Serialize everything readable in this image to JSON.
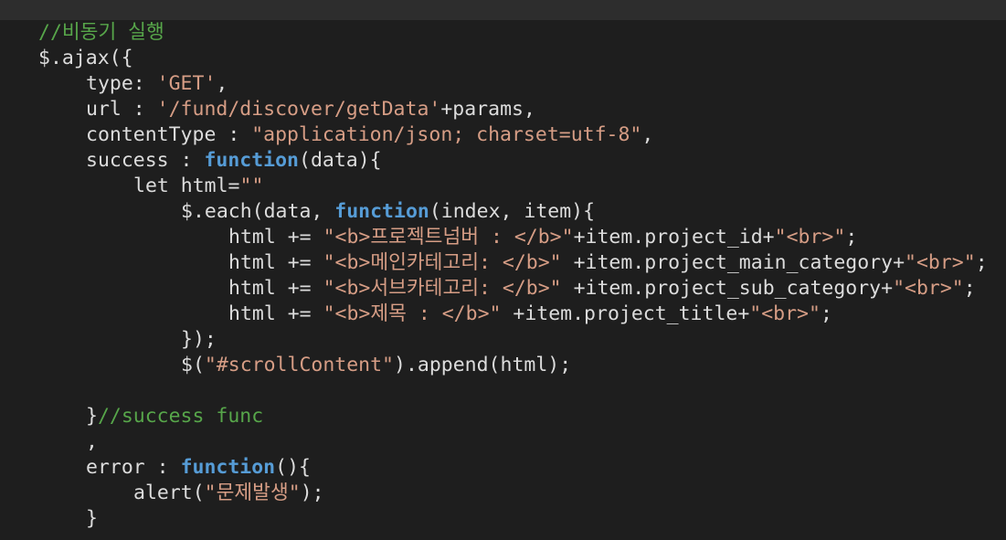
{
  "editor": {
    "lines": [
      [
        {
          "t": "comment",
          "v": "//비동기 실행"
        }
      ],
      [
        {
          "t": "plain",
          "v": "$.ajax({"
        }
      ],
      [
        {
          "t": "plain",
          "v": "type: "
        },
        {
          "t": "string",
          "v": "'GET'"
        },
        {
          "t": "plain",
          "v": ","
        }
      ],
      [
        {
          "t": "plain",
          "v": "url : "
        },
        {
          "t": "string",
          "v": "'/fund/discover/getData'"
        },
        {
          "t": "plain",
          "v": "+params,"
        }
      ],
      [
        {
          "t": "plain",
          "v": "contentType : "
        },
        {
          "t": "string",
          "v": "\"application/json; charset=utf-8\""
        },
        {
          "t": "plain",
          "v": ","
        }
      ],
      [
        {
          "t": "plain",
          "v": "success : "
        },
        {
          "t": "keyword",
          "v": "function"
        },
        {
          "t": "plain",
          "v": "(data){"
        }
      ],
      [
        {
          "t": "plain",
          "v": "let html="
        },
        {
          "t": "string",
          "v": "\"\""
        }
      ],
      [
        {
          "t": "plain",
          "v": "$.each(data, "
        },
        {
          "t": "keyword",
          "v": "function"
        },
        {
          "t": "plain",
          "v": "(index, item){"
        }
      ],
      [
        {
          "t": "plain",
          "v": "html += "
        },
        {
          "t": "string",
          "v": "\"<b>프로젝트넘버 : </b>\""
        },
        {
          "t": "plain",
          "v": "+item.project_id+"
        },
        {
          "t": "string",
          "v": "\"<br>\""
        },
        {
          "t": "plain",
          "v": ";"
        }
      ],
      [
        {
          "t": "plain",
          "v": "html += "
        },
        {
          "t": "string",
          "v": "\"<b>메인카테고리: </b>\""
        },
        {
          "t": "plain",
          "v": " +item.project_main_category+"
        },
        {
          "t": "string",
          "v": "\"<br>\""
        },
        {
          "t": "plain",
          "v": ";"
        }
      ],
      [
        {
          "t": "plain",
          "v": "html += "
        },
        {
          "t": "string",
          "v": "\"<b>서브카테고리: </b>\""
        },
        {
          "t": "plain",
          "v": " +item.project_sub_category+"
        },
        {
          "t": "string",
          "v": "\"<br>\""
        },
        {
          "t": "plain",
          "v": ";"
        }
      ],
      [
        {
          "t": "plain",
          "v": "html += "
        },
        {
          "t": "string",
          "v": "\"<b>제목 : </b>\""
        },
        {
          "t": "plain",
          "v": " +item.project_title+"
        },
        {
          "t": "string",
          "v": "\"<br>\""
        },
        {
          "t": "plain",
          "v": ";"
        }
      ],
      [
        {
          "t": "plain",
          "v": "});"
        }
      ],
      [
        {
          "t": "plain",
          "v": "$("
        },
        {
          "t": "string",
          "v": "\"#scrollContent\""
        },
        {
          "t": "plain",
          "v": ").append(html);"
        }
      ],
      [],
      [
        {
          "t": "plain",
          "v": "}"
        },
        {
          "t": "comment",
          "v": "//success func"
        }
      ],
      [
        {
          "t": "plain",
          "v": ","
        }
      ],
      [
        {
          "t": "plain",
          "v": "error : "
        },
        {
          "t": "keyword",
          "v": "function"
        },
        {
          "t": "plain",
          "v": "(){"
        }
      ],
      [
        {
          "t": "plain",
          "v": "alert("
        },
        {
          "t": "string",
          "v": "\"문제발생\""
        },
        {
          "t": "plain",
          "v": ");"
        }
      ],
      [
        {
          "t": "plain",
          "v": "}"
        }
      ]
    ]
  }
}
